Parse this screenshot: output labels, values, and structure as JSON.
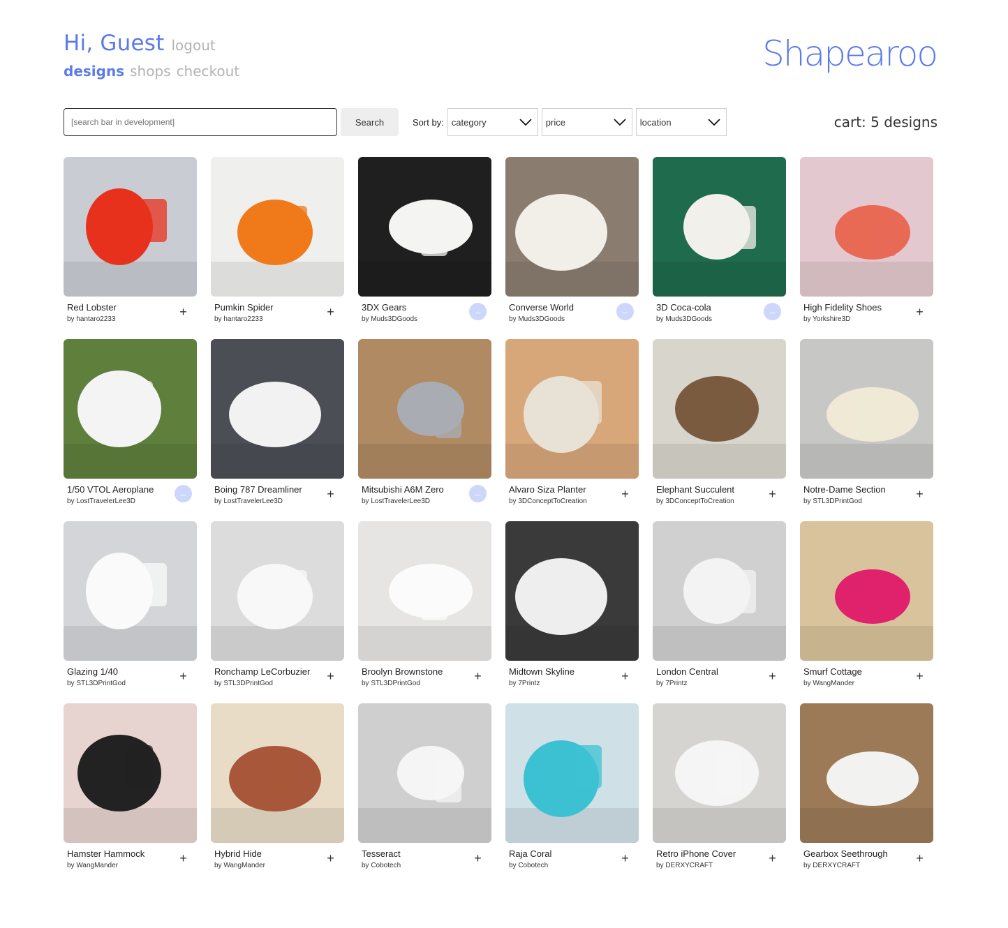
{
  "header": {
    "greeting": "Hi, Guest",
    "logout": "logout",
    "nav": [
      {
        "label": "designs",
        "active": true
      },
      {
        "label": "shops",
        "active": false
      },
      {
        "label": "checkout",
        "active": false
      }
    ],
    "brand": "Shapearoo"
  },
  "toolbar": {
    "search_placeholder": "[search bar in development]",
    "search_button": "Search",
    "sort_label": "Sort by:",
    "sort_options": [
      "category",
      "price",
      "location"
    ],
    "cart": "cart: 5 designs"
  },
  "colors": {
    "accent": "#5b7bea",
    "muted": "#b3b3b3",
    "added_badge": "#cdd6fb"
  },
  "designs": [
    {
      "name": "Red Lobster",
      "by": "by hantaro2233",
      "in_cart": false,
      "bg": "#c9ccd3",
      "fg": "#e8311c"
    },
    {
      "name": "Pumkin Spider",
      "by": "by hantaro2233",
      "in_cart": false,
      "bg": "#efefed",
      "fg": "#f07a1a"
    },
    {
      "name": "3DX Gears",
      "by": "by Muds3DGoods",
      "in_cart": true,
      "bg": "#1f1f1f",
      "fg": "#f4f4f2"
    },
    {
      "name": "Converse World",
      "by": "by Muds3DGoods",
      "in_cart": true,
      "bg": "#8a7d70",
      "fg": "#f1efe8"
    },
    {
      "name": "3D Coca-cola",
      "by": "by Muds3DGoods",
      "in_cart": true,
      "bg": "#1f6b4e",
      "fg": "#f2f0ea"
    },
    {
      "name": "High Fidelity Shoes",
      "by": "by Yorkshire3D",
      "in_cart": false,
      "bg": "#e3c9cf",
      "fg": "#e86a55"
    },
    {
      "name": "1/50 VTOL Aeroplane",
      "by": "by LostTravelerLee3D",
      "in_cart": true,
      "bg": "#5f7f3c",
      "fg": "#f4f4f4"
    },
    {
      "name": "Boing 787 Dreamliner",
      "by": "by LostTravelerLee3D",
      "in_cart": false,
      "bg": "#4b4f55",
      "fg": "#f2f2f2"
    },
    {
      "name": "Mitsubishi A6M Zero",
      "by": "by LostTravelerLee3D",
      "in_cart": true,
      "bg": "#b08a63",
      "fg": "#a9adb3"
    },
    {
      "name": "Alvaro Siza Planter",
      "by": "by 3DConceptToCreation",
      "in_cart": false,
      "bg": "#d7a77a",
      "fg": "#e8e2d6"
    },
    {
      "name": "Elephant Succulent",
      "by": "by 3DConceptToCreation",
      "in_cart": false,
      "bg": "#d8d5cc",
      "fg": "#7a5b40"
    },
    {
      "name": "Notre-Dame Section",
      "by": "by STL3DPrintGod",
      "in_cart": false,
      "bg": "#c7c8c6",
      "fg": "#efe9d6"
    },
    {
      "name": "Glazing 1/40",
      "by": "by STL3DPrintGod",
      "in_cart": false,
      "bg": "#d3d5d8",
      "fg": "#fafafa"
    },
    {
      "name": "Ronchamp LeCorbuzier",
      "by": "by STL3DPrintGod",
      "in_cart": false,
      "bg": "#dcdcdc",
      "fg": "#f8f8f8"
    },
    {
      "name": "Broolyn Brownstone",
      "by": "by STL3DPrintGod",
      "in_cart": false,
      "bg": "#e6e5e3",
      "fg": "#fbfbfb"
    },
    {
      "name": "Midtown Skyline",
      "by": "by 7Printz",
      "in_cart": false,
      "bg": "#3a3a3a",
      "fg": "#eeeeee"
    },
    {
      "name": "London Central",
      "by": "by 7Printz",
      "in_cart": false,
      "bg": "#d0d0d0",
      "fg": "#f3f3f3"
    },
    {
      "name": "Smurf Cottage",
      "by": "by WangMander",
      "in_cart": false,
      "bg": "#d9c39c",
      "fg": "#e0216b"
    },
    {
      "name": "Hamster Hammock",
      "by": "by WangMander",
      "in_cart": false,
      "bg": "#e7d3cf",
      "fg": "#222222"
    },
    {
      "name": "Hybrid Hide",
      "by": "by WangMander",
      "in_cart": false,
      "bg": "#e8dcc6",
      "fg": "#a8573a"
    },
    {
      "name": "Tesseract",
      "by": "by Cobotech",
      "in_cart": false,
      "bg": "#cfcfcf",
      "fg": "#f5f5f5"
    },
    {
      "name": "Raja Coral",
      "by": "by Cobotech",
      "in_cart": false,
      "bg": "#cfe0e6",
      "fg": "#3cc1d2"
    },
    {
      "name": "Retro iPhone Cover",
      "by": "by DERXYCRAFT",
      "in_cart": false,
      "bg": "#d6d4d0",
      "fg": "#f5f5f5"
    },
    {
      "name": "Gearbox Seethrough",
      "by": "by DERXYCRAFT",
      "in_cart": false,
      "bg": "#9c7a58",
      "fg": "#f2f2f0"
    }
  ]
}
